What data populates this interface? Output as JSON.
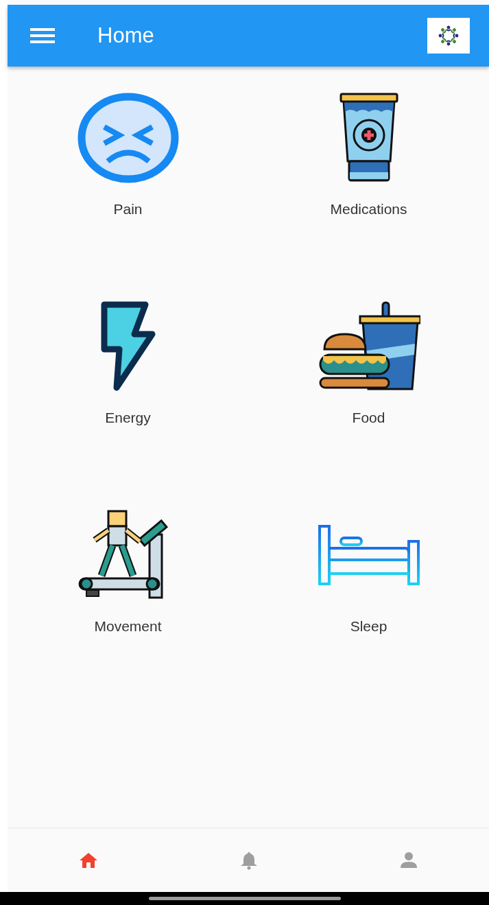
{
  "app_bar": {
    "title": "Home"
  },
  "tiles": [
    {
      "label": "Pain",
      "kind": "pain"
    },
    {
      "label": "Medications",
      "kind": "medications"
    },
    {
      "label": "Energy",
      "kind": "energy"
    },
    {
      "label": "Food",
      "kind": "food"
    },
    {
      "label": "Movement",
      "kind": "movement"
    },
    {
      "label": "Sleep",
      "kind": "sleep"
    }
  ],
  "bottom_nav": [
    {
      "kind": "home",
      "selected": true
    },
    {
      "kind": "notifications",
      "selected": false
    },
    {
      "kind": "profile",
      "selected": false
    }
  ]
}
